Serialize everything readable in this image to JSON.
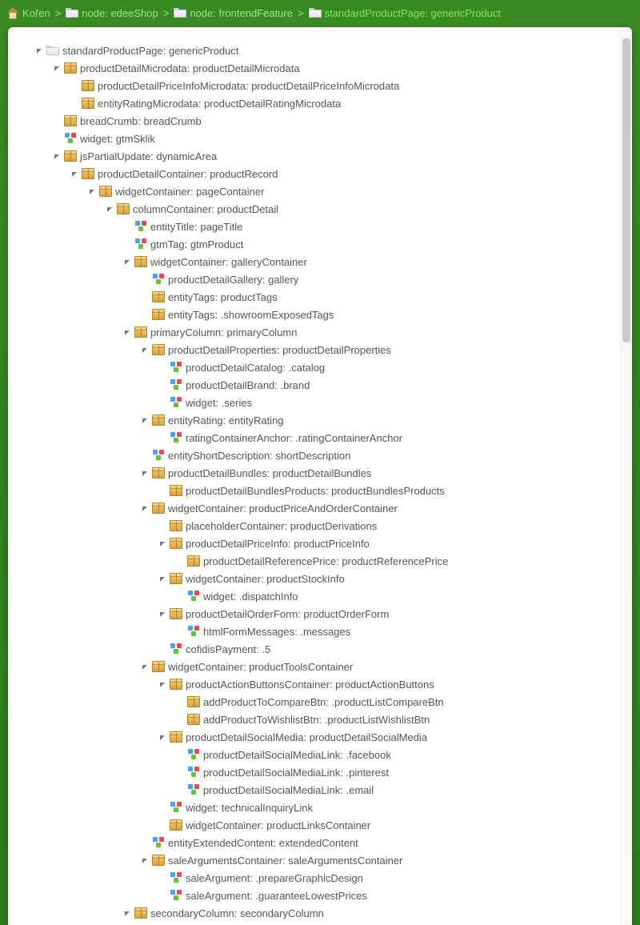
{
  "breadcrumb": [
    {
      "icon": "home",
      "label": "Kořen"
    },
    {
      "icon": "folder",
      "label": "node: edeeShop"
    },
    {
      "icon": "folder",
      "label": "node: frontendFeature"
    },
    {
      "icon": "folder",
      "label": "standardProductPage: genericProduct",
      "active": true
    }
  ],
  "tree": [
    {
      "d": 0,
      "exp": true,
      "icon": "folder",
      "label": "standardProductPage: genericProduct"
    },
    {
      "d": 1,
      "exp": true,
      "icon": "box",
      "label": "productDetailMicrodata: productDetailMicrodata"
    },
    {
      "d": 2,
      "exp": null,
      "icon": "box",
      "label": "productDetailPriceInfoMicrodata: productDetailPriceInfoMicrodata"
    },
    {
      "d": 2,
      "exp": null,
      "icon": "box",
      "label": "entityRatingMicrodata: productDetailRatingMicrodata"
    },
    {
      "d": 1,
      "exp": null,
      "icon": "box",
      "label": "breadCrumb: breadCrumb"
    },
    {
      "d": 1,
      "exp": null,
      "icon": "widget",
      "label": "widget: gtmSklik"
    },
    {
      "d": 1,
      "exp": true,
      "icon": "box",
      "label": "jsPartialUpdate: dynamicArea"
    },
    {
      "d": 2,
      "exp": true,
      "icon": "box",
      "label": "productDetailContainer: productRecord"
    },
    {
      "d": 3,
      "exp": true,
      "icon": "box",
      "label": "widgetContainer: pageContainer"
    },
    {
      "d": 4,
      "exp": true,
      "icon": "box",
      "label": "columnContainer: productDetail"
    },
    {
      "d": 5,
      "exp": null,
      "icon": "widget",
      "label": "entityTitle: pageTitle"
    },
    {
      "d": 5,
      "exp": null,
      "icon": "widget",
      "label": "gtmTag: gtmProduct"
    },
    {
      "d": 5,
      "exp": true,
      "icon": "box",
      "label": "widgetContainer: galleryContainer"
    },
    {
      "d": 6,
      "exp": null,
      "icon": "widget",
      "label": "productDetailGallery: gallery"
    },
    {
      "d": 6,
      "exp": null,
      "icon": "box",
      "label": "entityTags: productTags"
    },
    {
      "d": 6,
      "exp": null,
      "icon": "box",
      "label": "entityTags: .showroomExposedTags"
    },
    {
      "d": 5,
      "exp": true,
      "icon": "box",
      "label": "primaryColumn: primaryColumn"
    },
    {
      "d": 6,
      "exp": true,
      "icon": "box",
      "label": "productDetailProperties: productDetailProperties"
    },
    {
      "d": 7,
      "exp": null,
      "icon": "widget",
      "label": "productDetailCatalog: .catalog"
    },
    {
      "d": 7,
      "exp": null,
      "icon": "widget",
      "label": "productDetailBrand: .brand"
    },
    {
      "d": 7,
      "exp": null,
      "icon": "widget",
      "label": "widget: .series"
    },
    {
      "d": 6,
      "exp": true,
      "icon": "box",
      "label": "entityRating: entityRating"
    },
    {
      "d": 7,
      "exp": null,
      "icon": "widget",
      "label": "ratingContainerAnchor: .ratingContainerAnchor"
    },
    {
      "d": 6,
      "exp": null,
      "icon": "widget",
      "label": "entityShortDescription: shortDescription"
    },
    {
      "d": 6,
      "exp": true,
      "icon": "box",
      "label": "productDetailBundles: productDetailBundles"
    },
    {
      "d": 7,
      "exp": null,
      "icon": "box",
      "label": "productDetailBundlesProducts: productBundlesProducts"
    },
    {
      "d": 6,
      "exp": true,
      "icon": "box",
      "label": "widgetContainer: productPriceAndOrderContainer"
    },
    {
      "d": 7,
      "exp": null,
      "icon": "box",
      "label": "placeholderContainer: productDerivations"
    },
    {
      "d": 7,
      "exp": true,
      "icon": "box",
      "label": "productDetailPriceInfo: productPriceInfo"
    },
    {
      "d": 8,
      "exp": null,
      "icon": "box",
      "label": "productDetailReferencePrice: productReferencePrice"
    },
    {
      "d": 7,
      "exp": true,
      "icon": "box",
      "label": "widgetContainer: productStockInfo"
    },
    {
      "d": 8,
      "exp": null,
      "icon": "widget",
      "label": "widget: .dispatchInfo"
    },
    {
      "d": 7,
      "exp": true,
      "icon": "box",
      "label": "productDetailOrderForm: productOrderForm"
    },
    {
      "d": 8,
      "exp": null,
      "icon": "widget",
      "label": "htmlFormMessages: .messages"
    },
    {
      "d": 7,
      "exp": null,
      "icon": "widget",
      "label": "cofidisPayment: .5"
    },
    {
      "d": 6,
      "exp": true,
      "icon": "box",
      "label": "widgetContainer: productToolsContainer"
    },
    {
      "d": 7,
      "exp": true,
      "icon": "box",
      "label": "productActionButtonsContainer: productActionButtons"
    },
    {
      "d": 8,
      "exp": null,
      "icon": "box",
      "label": "addProductToCompareBtn: .productListCompareBtn"
    },
    {
      "d": 8,
      "exp": null,
      "icon": "box",
      "label": "addProductToWishlistBtn: .productListWishlistBtn"
    },
    {
      "d": 7,
      "exp": true,
      "icon": "box",
      "label": "productDetailSocialMedia: productDetailSocialMedia"
    },
    {
      "d": 8,
      "exp": null,
      "icon": "widget",
      "label": "productDetailSocialMediaLink: .facebook"
    },
    {
      "d": 8,
      "exp": null,
      "icon": "widget",
      "label": "productDetailSocialMediaLink: .pinterest"
    },
    {
      "d": 8,
      "exp": null,
      "icon": "widget",
      "label": "productDetailSocialMediaLink: .email"
    },
    {
      "d": 7,
      "exp": null,
      "icon": "widget",
      "label": "widget: technicalInquiryLink"
    },
    {
      "d": 7,
      "exp": null,
      "icon": "box",
      "label": "widgetContainer: productLinksContainer"
    },
    {
      "d": 6,
      "exp": null,
      "icon": "widget",
      "label": "entityExtendedContent: extendedContent"
    },
    {
      "d": 6,
      "exp": true,
      "icon": "box",
      "label": "saleArgumentsContainer: saleArgumentsContainer"
    },
    {
      "d": 7,
      "exp": null,
      "icon": "widget",
      "label": "saleArgument: .prepareGraphicDesign"
    },
    {
      "d": 7,
      "exp": null,
      "icon": "widget",
      "label": "saleArgument: .guaranteeLowestPrices"
    },
    {
      "d": 5,
      "exp": true,
      "icon": "box",
      "label": "secondaryColumn: secondaryColumn"
    }
  ]
}
